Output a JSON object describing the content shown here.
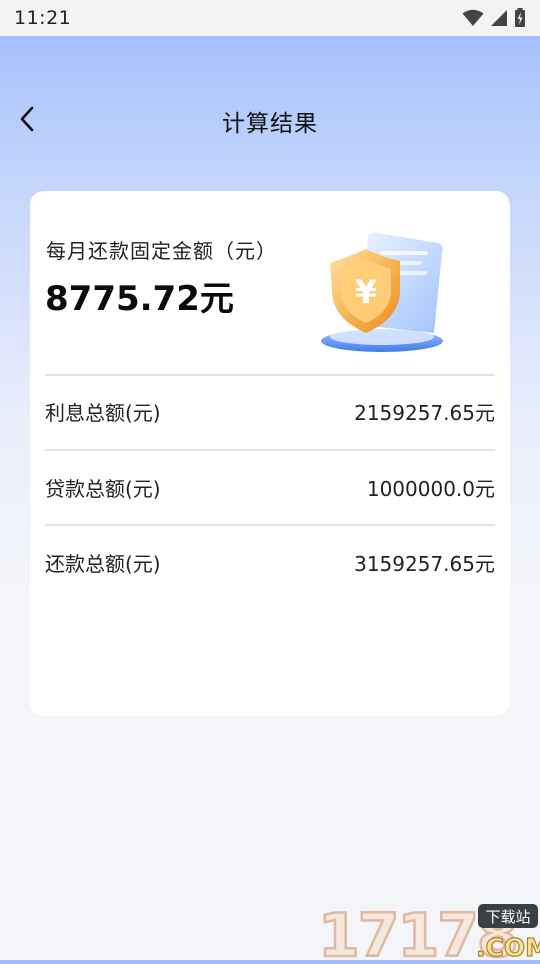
{
  "status_bar": {
    "time": "11:21",
    "icons": [
      "wifi-icon",
      "cellular-signal-icon",
      "battery-charging-icon"
    ]
  },
  "header": {
    "title": "计算结果",
    "back_icon": "chevron-left-icon"
  },
  "result": {
    "monthly_label": "每月还款固定金额（元）",
    "monthly_amount": "8775.72元",
    "illustration": "shield-yuan-icon",
    "rows": [
      {
        "label": "利息总额(元)",
        "value": "2159257.65元"
      },
      {
        "label": "贷款总额(元)",
        "value": "1000000.0元"
      },
      {
        "label": "还款总额(元)",
        "value": "3159257.65元"
      }
    ]
  },
  "watermark": {
    "brand": "17178",
    "suffix": ".COM",
    "tag": "下载站"
  },
  "colors": {
    "header_gradient_top": "#9fbcfb",
    "page_background": "#f4f5f9",
    "card_background": "#ffffff",
    "shield_gold": "#f6b24e",
    "illustration_blue": "#5a8ff0"
  }
}
